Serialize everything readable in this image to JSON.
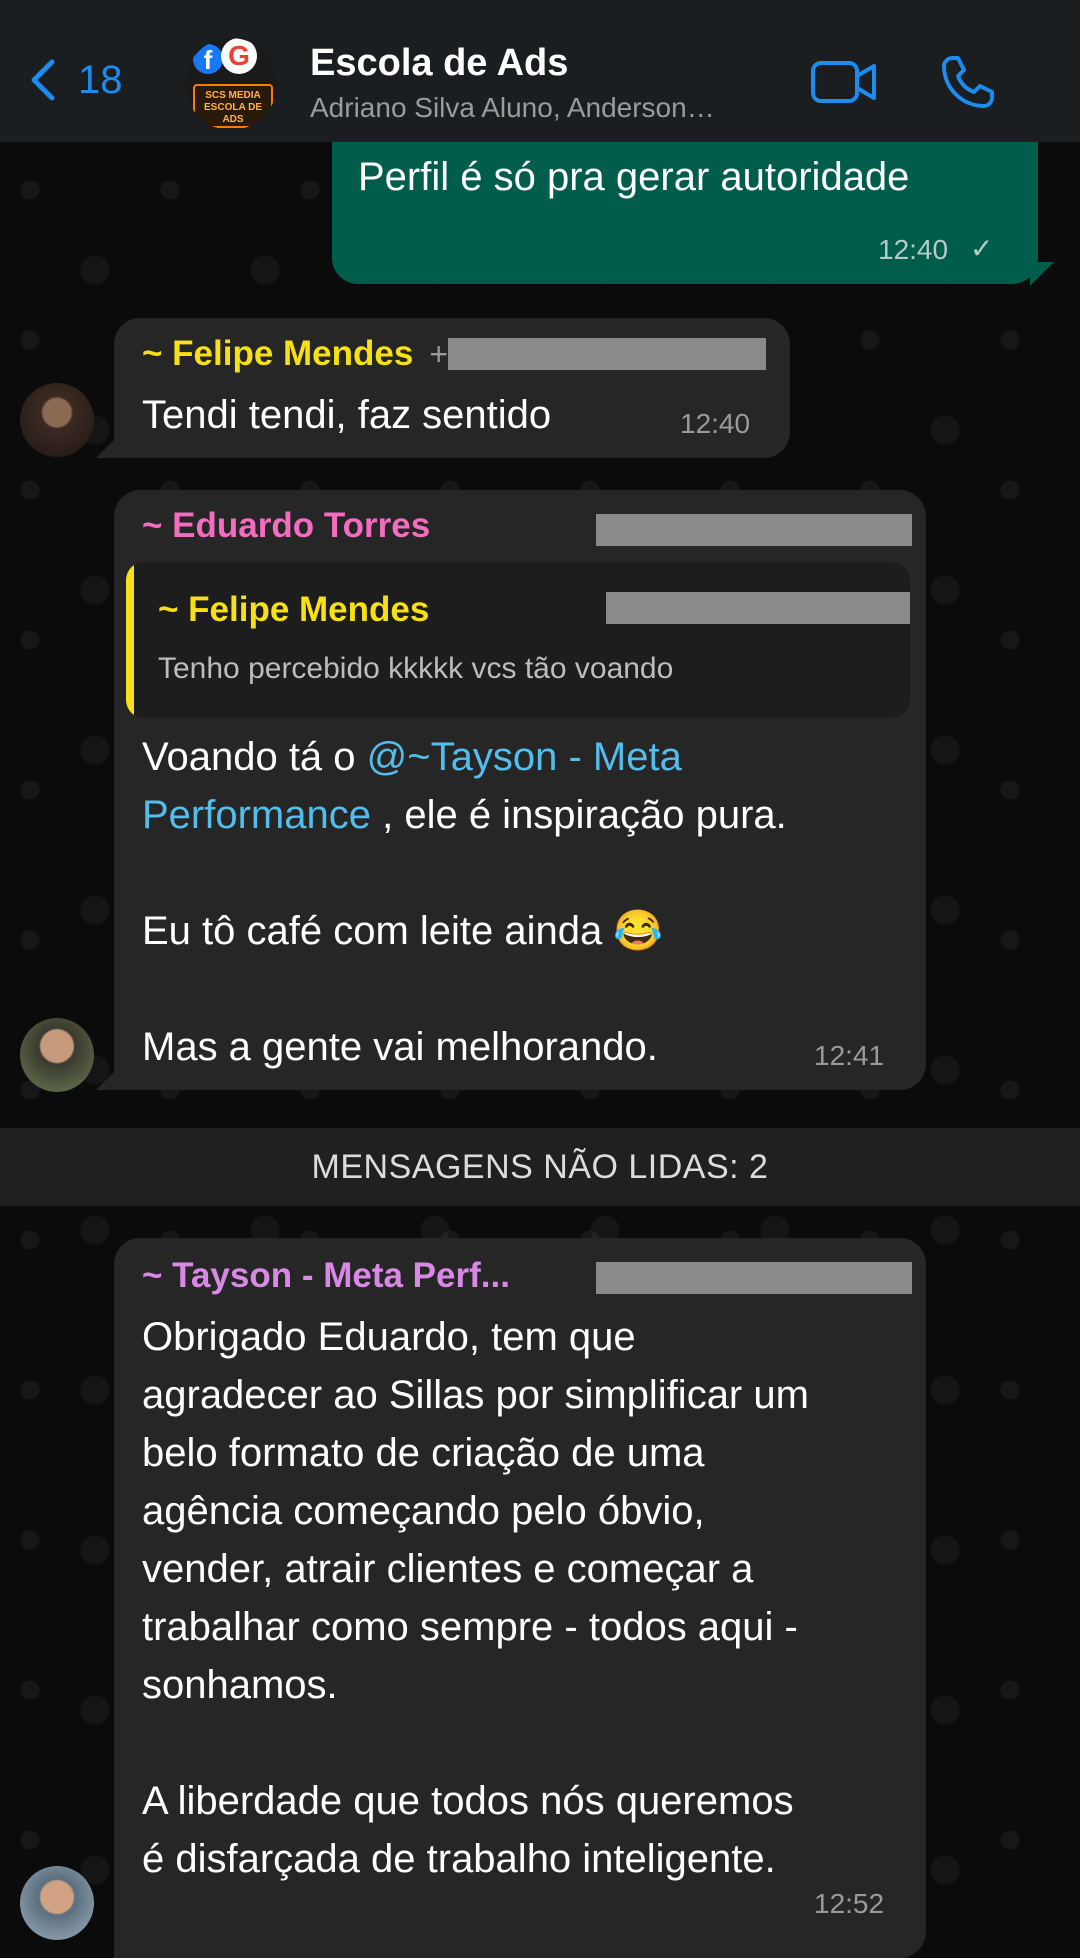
{
  "header": {
    "back_count": "18",
    "title": "Escola de Ads",
    "subtitle": "Adriano Silva Aluno, Anderson…",
    "avatar_text": "SCS MEDIA ESCOLA DE ADS"
  },
  "messages": [
    {
      "text": "Perfil é só pra gerar autoridade",
      "time": "12:40",
      "status": "✓"
    },
    {
      "sender": "~ Felipe Mendes",
      "text": "Tendi tendi, faz sentido",
      "time": "12:40"
    },
    {
      "sender": "~ Eduardo Torres",
      "quote": {
        "sender": "~ Felipe Mendes",
        "text": "Tenho percebido kkkkk vcs tão voando"
      },
      "text_before": "Voando tá o ",
      "mention": "@~Tayson - Meta Performance",
      "text_after": " , ele é inspiração pura.\n\nEu tô café com leite ainda 😂\n\nMas a gente vai melhorando.",
      "time": "12:41"
    },
    {
      "sender": "~ Tayson - Meta Perf...",
      "text": "Obrigado Eduardo, tem que\nagradecer ao Sillas por simplificar um\nbelo formato de criação de uma\nagência começando pelo óbvio,\nvender, atrair clientes e começar a\ntrabalhar como sempre - todos aqui -\nsonhamos.\n\nA liberdade que todos nós queremos\né disfarçada de trabalho inteligente.",
      "time": "12:52"
    }
  ],
  "unread_label": "MENSAGENS NÃO LIDAS: 2",
  "colors": {
    "accent": "#1b8cf0",
    "outgoing_bubble": "#005c4b",
    "incoming_bubble": "#262626",
    "felipe": "#f7e018",
    "eduardo": "#f36cbf",
    "tayson": "#d889e6",
    "mention": "#53bdeb"
  }
}
